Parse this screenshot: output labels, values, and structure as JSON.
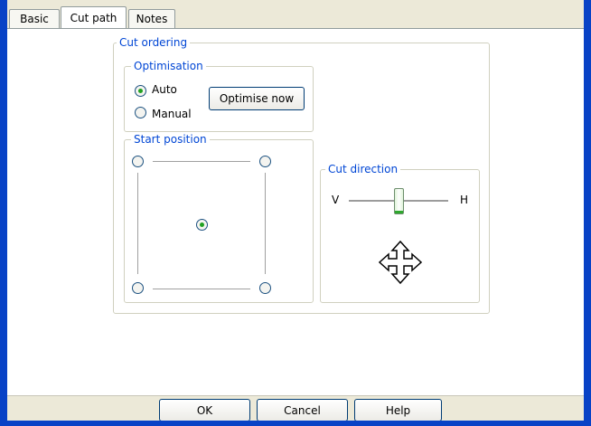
{
  "tabs": [
    {
      "label": "Basic",
      "active": false
    },
    {
      "label": "Cut path",
      "active": true
    },
    {
      "label": "Notes",
      "active": false
    }
  ],
  "cut_ordering": {
    "title": "Cut ordering",
    "optimisation": {
      "title": "Optimisation",
      "options": [
        {
          "label": "Auto",
          "selected": true
        },
        {
          "label": "Manual",
          "selected": false
        }
      ],
      "optimise_button": "Optimise now"
    },
    "start_position": {
      "title": "Start position",
      "selected": "center",
      "positions": [
        "top-left",
        "top-right",
        "center",
        "bottom-left",
        "bottom-right"
      ]
    },
    "cut_direction": {
      "title": "Cut direction",
      "left_label": "V",
      "right_label": "H",
      "slider_value": 0.5,
      "move_icon": "four-way-arrow-icon"
    }
  },
  "footer": {
    "ok": "OK",
    "cancel": "Cancel",
    "help": "Help"
  },
  "colors": {
    "frame": "#0842c6",
    "chrome": "#ece9d8",
    "legend_text": "#0046d5",
    "radio_dot": "#21a121"
  }
}
